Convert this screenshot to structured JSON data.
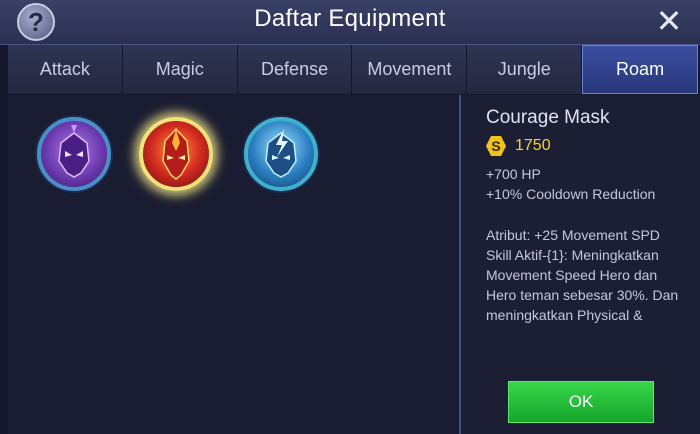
{
  "header": {
    "help_label": "?",
    "title": "Daftar Equipment",
    "close_label": "✕"
  },
  "tabs": [
    {
      "label": "Attack",
      "active": false
    },
    {
      "label": "Magic",
      "active": false
    },
    {
      "label": "Defense",
      "active": false
    },
    {
      "label": "Movement",
      "active": false
    },
    {
      "label": "Jungle",
      "active": false
    },
    {
      "label": "Roam",
      "active": true
    }
  ],
  "items": [
    {
      "icon": "purple-mask-icon",
      "selected": false
    },
    {
      "icon": "flame-mask-icon",
      "selected": true
    },
    {
      "icon": "lightning-mask-icon",
      "selected": false
    }
  ],
  "detail": {
    "name": "Courage Mask",
    "currency_symbol": "S",
    "price": "1750",
    "stats": [
      "+700 HP",
      "+10% Cooldown Reduction"
    ],
    "description": "Atribut: +25 Movement SPD\nSkill Aktif-{1}: Meningkatkan Movement Speed Hero dan Hero teman sebesar 30%. Dan meningkatkan Physical &"
  },
  "ok_label": "OK",
  "colors": {
    "active_tab": "#2f4291",
    "ok_green": "#1fb534",
    "price_gold": "#f5d33a"
  }
}
